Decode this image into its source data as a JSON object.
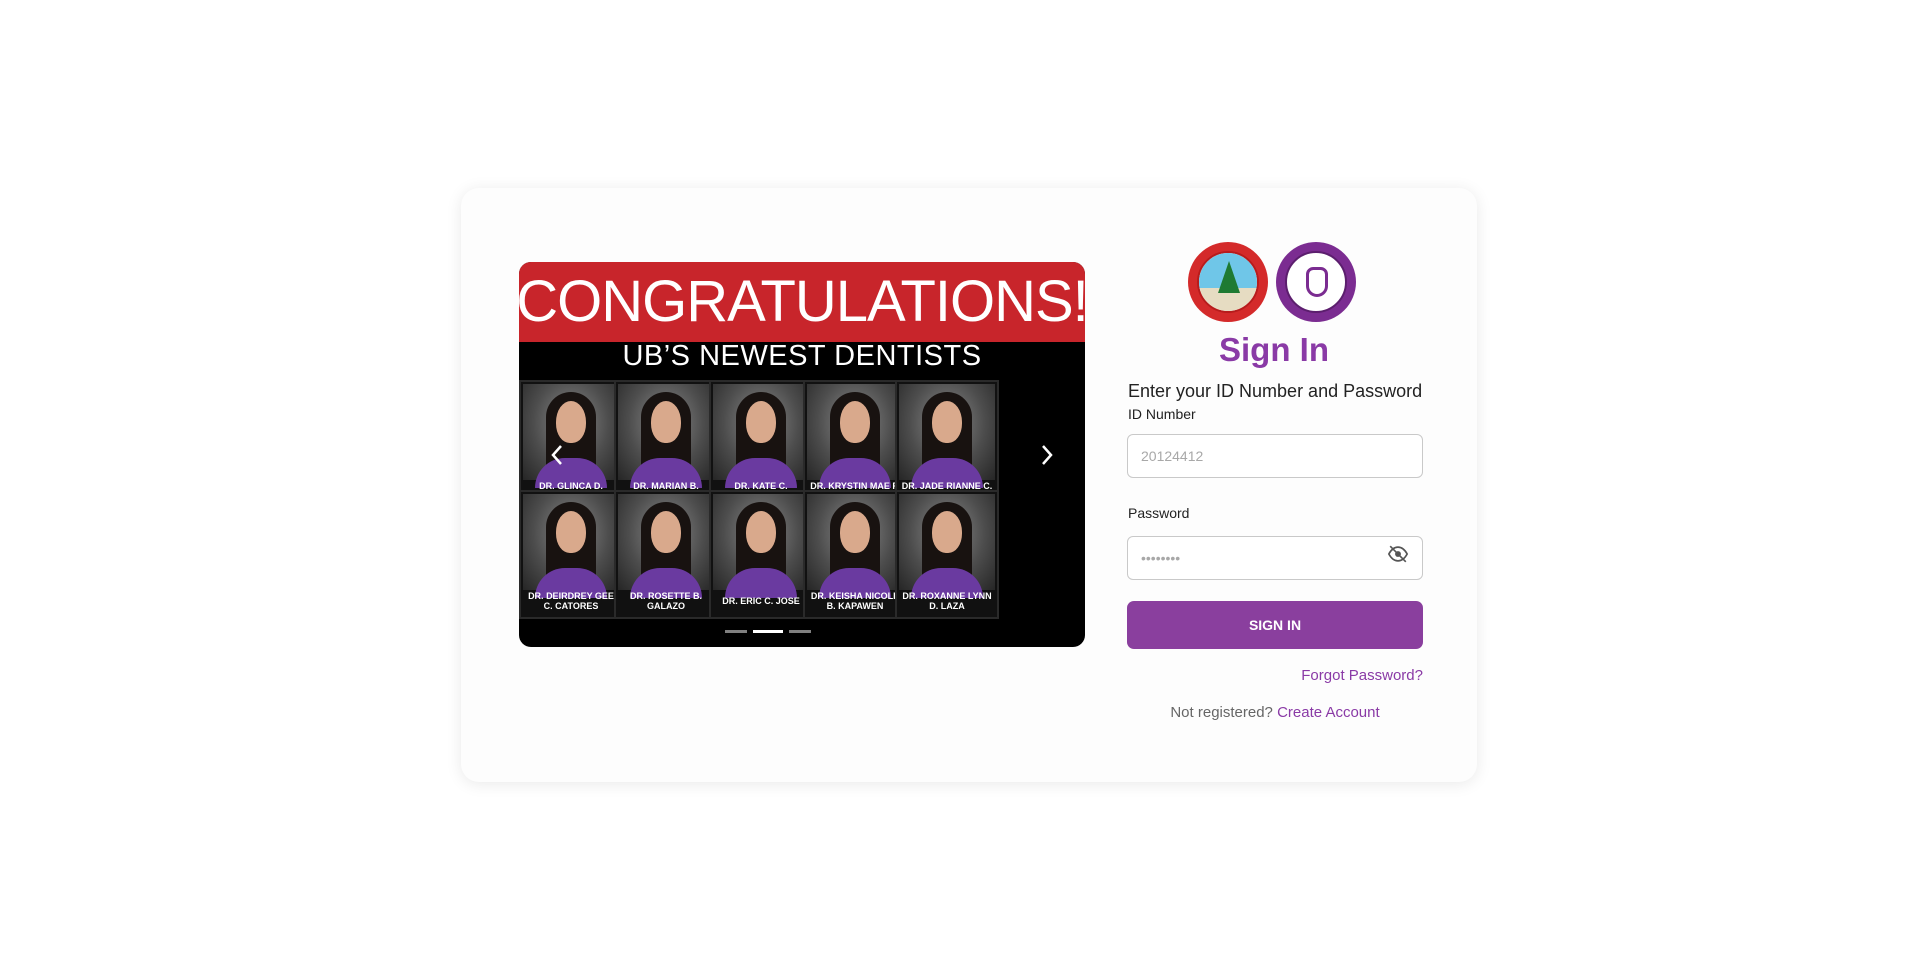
{
  "carousel": {
    "banner_title": "CONGRATULATIONS!",
    "banner_subtitle": "UB’S NEWEST DENTISTS",
    "prev_icon": "chevron-left-icon",
    "next_icon": "chevron-right-icon",
    "slide_count": 3,
    "active_slide": 2,
    "dentists": [
      {
        "name": "DR. GLINCA D. ABULAG"
      },
      {
        "name": "DR. MARIAN B. AGWIKING"
      },
      {
        "name": "DR. KATE C. ALINDAYO"
      },
      {
        "name": "DR. KRYSTIN MAE P. BEN"
      },
      {
        "name": "DR. JADE RIANNE C. CALIXTO"
      },
      {
        "name": "DR. DEIRDREY GEE C. CATORES"
      },
      {
        "name": "DR. ROSETTE B. GALAZO"
      },
      {
        "name": "DR. ERIC C. JOSE"
      },
      {
        "name": "DR. KEISHA NICOLE B. KAPAWEN"
      },
      {
        "name": "DR. ROXANNE LYNN D. LAZA"
      }
    ]
  },
  "login": {
    "logos": [
      "ub-seal-logo",
      "school-of-dentistry-seal-logo"
    ],
    "title": "Sign In",
    "subtitle": "Enter your ID Number and Password",
    "id_label": "ID Number",
    "id_placeholder": "20124412",
    "password_label": "Password",
    "password_placeholder": "••••••••",
    "eye_icon": "eye-slash-icon",
    "submit_label": "SIGN IN",
    "forgot_label": "Forgot Password?",
    "not_registered_text": "Not registered?",
    "create_account_label": "Create Account"
  },
  "colors": {
    "accent": "#8a3f9e",
    "banner_red": "#c8252b",
    "banner_black": "#000000"
  }
}
